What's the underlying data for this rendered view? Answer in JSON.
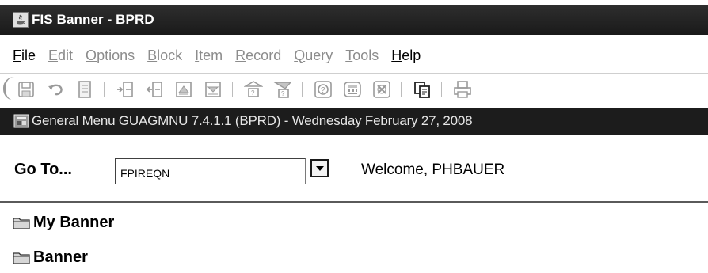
{
  "window": {
    "title": "FIS Banner - BPRD",
    "icon": "java-icon"
  },
  "menubar": {
    "items": [
      {
        "label": "File",
        "mnemonic": "F",
        "rest": "ile",
        "enabled": true
      },
      {
        "label": "Edit",
        "mnemonic": "E",
        "rest": "dit",
        "enabled": false
      },
      {
        "label": "Options",
        "mnemonic": "O",
        "rest": "ptions",
        "enabled": false
      },
      {
        "label": "Block",
        "mnemonic": "B",
        "rest": "lock",
        "enabled": false
      },
      {
        "label": "Item",
        "mnemonic": "I",
        "rest": "tem",
        "enabled": false
      },
      {
        "label": "Record",
        "mnemonic": "R",
        "rest": "ecord",
        "enabled": false
      },
      {
        "label": "Query",
        "mnemonic": "Q",
        "rest": "uery",
        "enabled": false
      },
      {
        "label": "Tools",
        "mnemonic": "T",
        "rest": "ools",
        "enabled": false
      },
      {
        "label": "Help",
        "mnemonic": "H",
        "rest": "elp",
        "enabled": true
      }
    ]
  },
  "toolbar": {
    "buttons": [
      "save-icon",
      "rollback-icon",
      "document-icon",
      "insert-record-icon",
      "remove-record-icon",
      "select-record-icon",
      "next-block-icon",
      "enter-query-icon",
      "execute-query-icon",
      "help-icon",
      "calculator-icon",
      "cancel-icon",
      "copy-icon",
      "print-icon"
    ]
  },
  "form": {
    "title": "General Menu  GUAGMNU  7.4.1.1  (BPRD) - Wednesday February 27, 2008",
    "goto_label": "Go To...",
    "goto_value": "FPIREQN",
    "welcome": "Welcome, PHBAUER"
  },
  "tree": {
    "items": [
      {
        "label": "My Banner",
        "icon": "folder-icon"
      },
      {
        "label": "Banner",
        "icon": "folder-icon"
      }
    ]
  },
  "colors": {
    "titlebar": "#1c1c1c",
    "disabled_menu": "#8c8c8c",
    "icon_gray": "#9a9a9a"
  }
}
